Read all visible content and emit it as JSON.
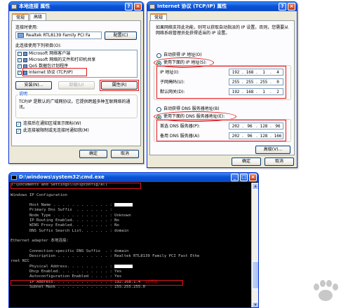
{
  "local_conn": {
    "title": "本地连接 属性",
    "tabs": [
      "常规",
      "高级"
    ],
    "connect_using_label": "连接时使用:",
    "adapter": "Realtek RTL8139 Family PCI Fa",
    "config_button": "配置(C)",
    "components_label": "此连接使用下列项目(O):",
    "components": [
      {
        "label": "Microsoft 网络客户端",
        "checked": true
      },
      {
        "label": "Microsoft 网络的文件和打印机共享",
        "checked": true
      },
      {
        "label": "QoS 数据包计划程序",
        "checked": true
      },
      {
        "label": "Internet 协议 (TCP/IP)",
        "checked": true
      }
    ],
    "install_button": "安装(N)...",
    "uninstall_button": "卸载(U)",
    "properties_button": "属性(R)",
    "desc_group": "说明",
    "desc_text": "TCP/IP 是默认的广域网协议。它提供跨越多种互联网络的通讯。",
    "show_icon_label": "连接后在通知区域显示图标(W)",
    "notify_label": "此连接被限制或无连接时通知我(M)",
    "ok_button": "确定",
    "cancel_button": "取消"
  },
  "tcpip": {
    "title": "Internet 协议 (TCP/IP) 属性",
    "tabs": [
      "常规"
    ],
    "intro": "如果网络支持此功能，则可以获取自动指派的 IP 设置。否则，您需要从网络系统管理员处获得适当的 IP 设置。",
    "auto_ip": "自动获得 IP 地址(O)",
    "use_ip": "使用下面的 IP 地址(S):",
    "ip_label": "IP 地址(I):",
    "ip": [
      "192",
      "168",
      "1",
      "4"
    ],
    "mask_label": "子网掩码(U):",
    "mask": [
      "255",
      "255",
      "255",
      "0"
    ],
    "gateway_label": "默认网关(D):",
    "gateway": [
      "192",
      "168",
      "1",
      "2"
    ],
    "auto_dns": "自动获得 DNS 服务器地址(B)",
    "use_dns": "使用下面的 DNS 服务器地址(E):",
    "dns1_label": "首选 DNS 服务器(P):",
    "dns1": [
      "202",
      "96",
      "128",
      "96"
    ],
    "dns2_label": "备用 DNS 服务器(A):",
    "dns2": [
      "202",
      "96",
      "128",
      "166"
    ],
    "advanced_button": "高级(V)...",
    "ok_button": "确定",
    "cancel_button": "取消"
  },
  "cmd": {
    "title": "D:\\windows\\system32\\cmd.exe",
    "lines": [
      {
        "text": "D:\\Documents and Settings\\lu>ipconfig/all"
      },
      {
        "text": ""
      },
      {
        "text": "Windows IP Configuration"
      },
      {
        "text": ""
      },
      {
        "text": "        Host Name . . . . . . . . . . . . : ",
        "mask": true
      },
      {
        "text": "        Primary Dns Suffix  . . . . . . . : "
      },
      {
        "text": "        Node Type . . . . . . . . . . . . : Unknown"
      },
      {
        "text": "        IP Routing Enabled. . . . . . . . : No"
      },
      {
        "text": "        WINS Proxy Enabled. . . . . . . . : No"
      },
      {
        "text": "        DNS Suffix Search List. . . . . . : domain"
      },
      {
        "text": ""
      },
      {
        "text": "Ethernet adapter 本地连接:"
      },
      {
        "text": ""
      },
      {
        "text": "        Connection-specific DNS Suffix  . : domain"
      },
      {
        "text": "        Description . . . . . . . . . . . : Realtek RTL8139 Family PCI Fast Ethe"
      },
      {
        "text": "rnet NIC"
      },
      {
        "text": "        Physical Address. . . . . . . . . : ",
        "mask": true
      },
      {
        "text": "        Dhcp Enabled. . . . . . . . . . . : Yes"
      },
      {
        "text": "        Autoconfiguration Enabled . . . . : Yes"
      },
      {
        "text": "        IP Address. . . . . . . . . . . . : 192.168.1.4",
        "note": "IP地址"
      },
      {
        "text": "        Subnet Mask . . . . . . . . . . . : 255.255.255.0"
      }
    ]
  },
  "colors": {
    "xp_blue": "#0a52d6",
    "annotation_red": "#e0161b",
    "dialog_bg": "#ece9d8"
  }
}
